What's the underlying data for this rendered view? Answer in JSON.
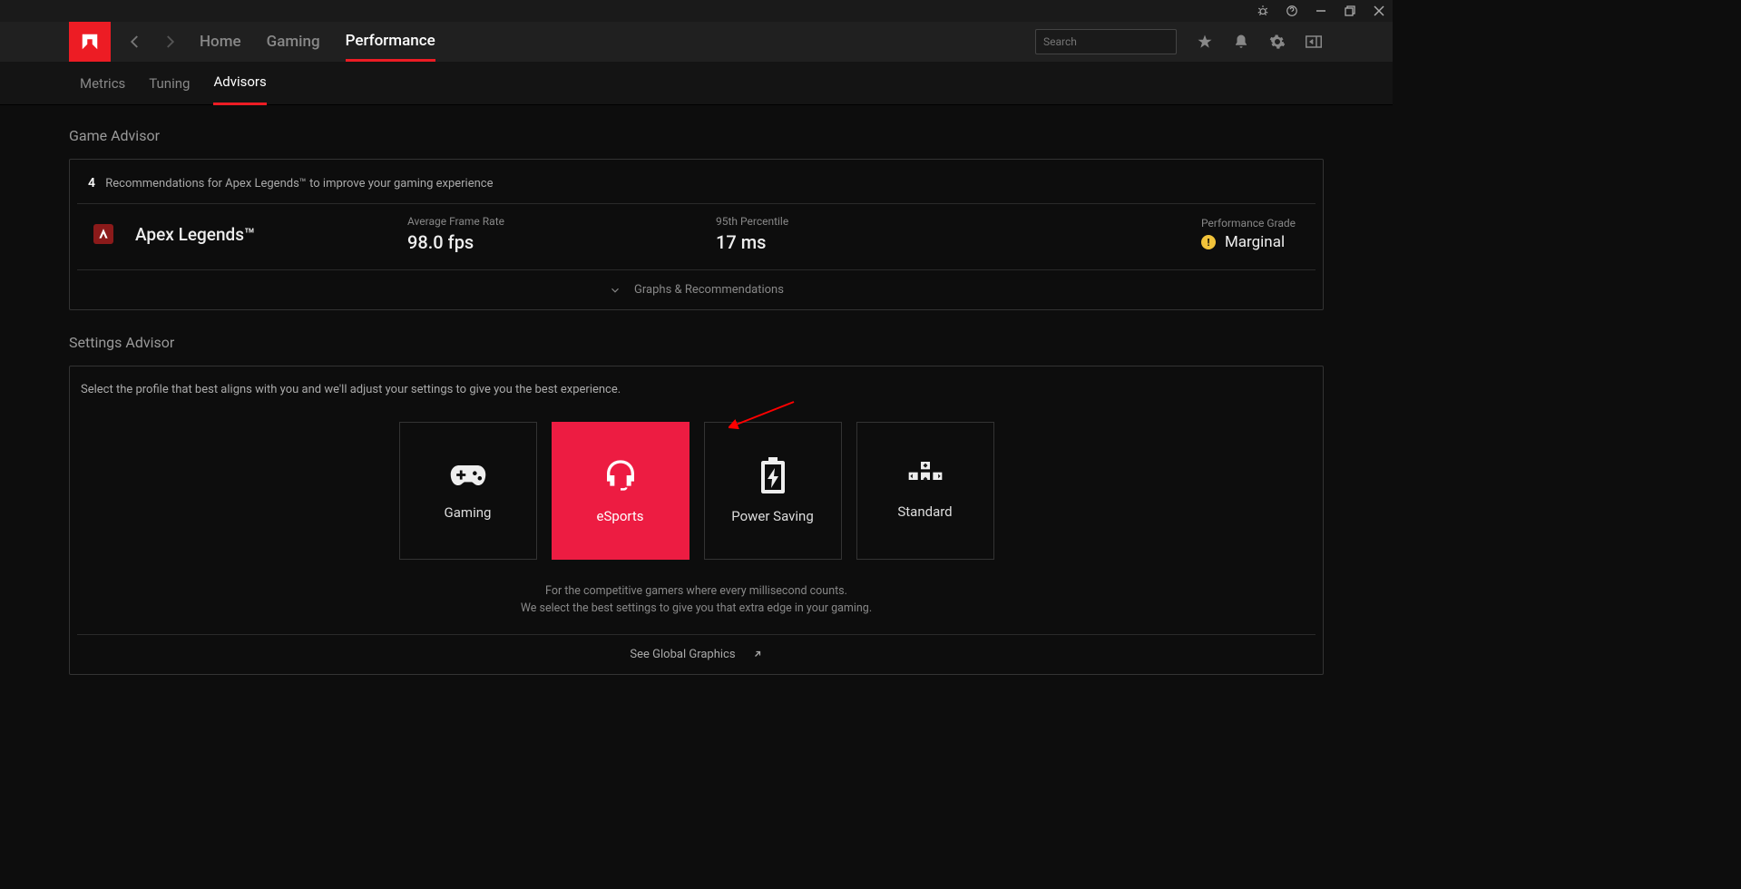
{
  "titlebar": {},
  "nav": {
    "tabs": [
      {
        "label": "Home",
        "active": false
      },
      {
        "label": "Gaming",
        "active": false
      },
      {
        "label": "Performance",
        "active": true
      }
    ],
    "search_placeholder": "Search"
  },
  "subnav": {
    "tabs": [
      {
        "label": "Metrics",
        "active": false
      },
      {
        "label": "Tuning",
        "active": false
      },
      {
        "label": "Advisors",
        "active": true
      }
    ]
  },
  "game_advisor": {
    "title": "Game Advisor",
    "count": "4",
    "rec_text": "Recommendations for Apex Legends™ to improve your gaming experience",
    "game_name": "Apex Legends™",
    "afr_label": "Average Frame Rate",
    "afr_value": "98.0 fps",
    "p95_label": "95th Percentile",
    "p95_value": "17 ms",
    "grade_label": "Performance Grade",
    "grade_value": "Marginal",
    "expand_label": "Graphs & Recommendations"
  },
  "settings_advisor": {
    "title": "Settings Advisor",
    "desc": "Select the profile that best aligns with you and we'll adjust your settings to give you the best experience.",
    "profiles": [
      {
        "label": "Gaming",
        "active": false
      },
      {
        "label": "eSports",
        "active": true
      },
      {
        "label": "Power Saving",
        "active": false
      },
      {
        "label": "Standard",
        "active": false
      }
    ],
    "profile_desc_line1": "For the competitive gamers where every millisecond counts.",
    "profile_desc_line2": "We select the best settings to give you that extra edge in your gaming.",
    "footer_link": "See Global Graphics"
  }
}
